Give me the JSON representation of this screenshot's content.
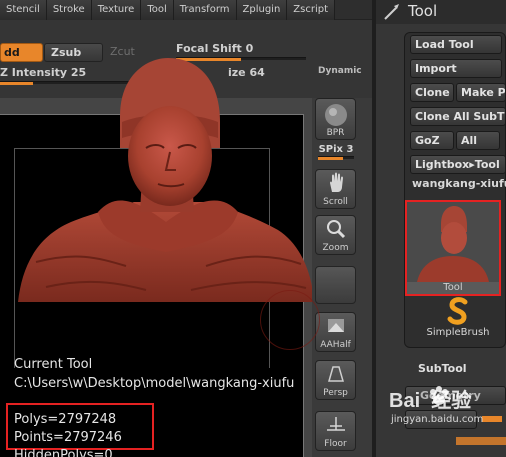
{
  "menu": [
    "Stencil",
    "Stroke",
    "Texture",
    "Tool",
    "Transform",
    "Zplugin",
    "Zscript"
  ],
  "shelf": {
    "zadd_label": "dd",
    "zsub_label": "Zsub",
    "zcut_label": "Zcut",
    "focal_shift_label": "Focal Shift 0",
    "focal_shift_value": 0.5,
    "intensity_label": "Z Intensity 25",
    "intensity_value": 0.25,
    "draw_size_label": "ize 64",
    "draw_size_value": 0.3,
    "dynamic_label": "Dynamic"
  },
  "strip": {
    "bpr_label": "BPR",
    "spix_label": "SPix 3",
    "spix_value": 0.7,
    "scroll_label": "Scroll",
    "zoom_label": "Zoom",
    "aahalf_label": "AAHalf",
    "persp_label": "Persp",
    "floor_label": "Floor"
  },
  "info": {
    "current_tool_label": "Current Tool",
    "path": "C:\\Users\\w\\Desktop\\model\\wangkang-xiufu",
    "polys": "Polys=2797248",
    "points": "Points=2797246",
    "hidden_polys": "HiddenPolys=0"
  },
  "palette": {
    "title": "Tool",
    "buttons": {
      "load_tool": "Load Tool",
      "import": "Import",
      "clone": "Clone",
      "make_poly": "Make P",
      "clone_all_subtools": "Clone All SubT",
      "goz": "GoZ",
      "all": "All",
      "lightbox_tools": "Lightbox▸Tool"
    },
    "tool_name": "wangkang-xiufu",
    "thumb_label": "Tool",
    "simple_brush_label": "SimpleBrush",
    "subtool_label": "SubTool",
    "geometry_label": "Geometry"
  },
  "colors": {
    "accent_orange": "#e8862a",
    "highlight_red": "#e52222",
    "model_red": "#a8412f"
  },
  "watermark": {
    "brand": "Bai  经验",
    "url": "jingyan.baidu.com"
  },
  "icons": {
    "brush": "brush-icon",
    "bpr": "sphere-icon",
    "scroll": "hand-icon",
    "zoom": "magnifier-icon",
    "aahalf": "aahalf-icon",
    "persp": "perspective-icon",
    "floor": "floor-icon",
    "simple_brush": "s-brush-icon"
  }
}
